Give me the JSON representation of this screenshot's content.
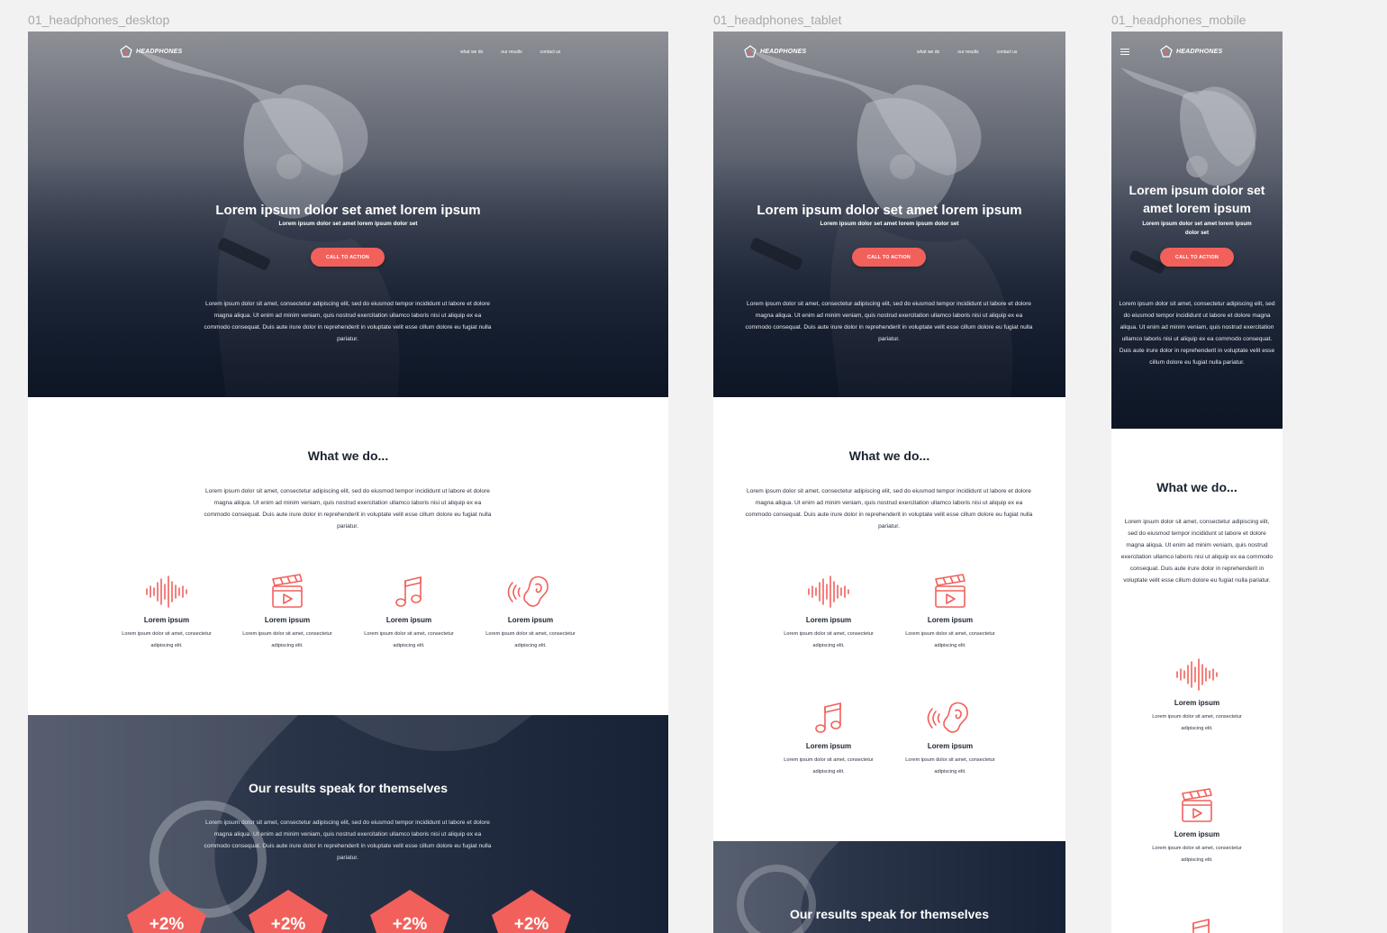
{
  "frames": {
    "desktop_label": "01_headphones_desktop",
    "tablet_label": "01_headphones_tablet",
    "mobile_label": "01_headphones_mobile"
  },
  "brand": {
    "name": "HEADPHONES"
  },
  "nav": {
    "items": [
      "what we do",
      "our results",
      "contact us"
    ]
  },
  "hero": {
    "title": "Lorem ipsum dolor set amet lorem ipsum",
    "subtitle": "Lorem ipsum dolor set amet lorem ipsum dolor set",
    "cta": "CALL TO ACTION",
    "body": "Lorem ipsum dolor sit amet, consectetur adipiscing elit, sed do eiusmod tempor incididunt ut labore et dolore magna aliqua. Ut enim ad minim veniam, quis nostrud exercitation ullamco laboris nisi ut aliquip ex ea commodo consequat. Duis aute irure dolor in reprehenderit in voluptate velit esse cillum dolore eu fugiat nulla pariatur."
  },
  "what_we_do": {
    "title": "What we do...",
    "body": "Lorem ipsum dolor sit amet, consectetur adipiscing elit, sed do eiusmod tempor incididunt ut labore et dolore magna aliqua. Ut enim ad minim veniam, quis nostrud exercitation ullamco laboris nisi ut aliquip ex ea commodo consequat. Duis aute irure dolor in reprehenderit in voluptate velit esse cillum dolore eu fugiat nulla pariatur.",
    "features": [
      {
        "icon": "sound-wave-icon",
        "title": "Lorem ipsum",
        "desc": "Lorem ipsum dolor sit amet, consectetur adipiscing elit."
      },
      {
        "icon": "clapperboard-icon",
        "title": "Lorem ipsum",
        "desc": "Lorem ipsum dolor sit amet, consectetur adipiscing elit."
      },
      {
        "icon": "music-note-icon",
        "title": "Lorem ipsum",
        "desc": "Lorem ipsum dolor sit amet, consectetur adipiscing elit."
      },
      {
        "icon": "ear-icon",
        "title": "Lorem ipsum",
        "desc": "Lorem ipsum dolor sit amet, consectetur adipiscing elit."
      }
    ]
  },
  "results": {
    "title": "Our results speak for themselves",
    "body": "Lorem ipsum dolor sit amet, consectetur adipiscing elit, sed do eiusmod tempor incididunt ut labore et dolore magna aliqua. Ut enim ad minim veniam, quis nostrud exercitation ullamco laboris nisi ut aliquip ex ea commodo consequat. Duis aute irure dolor in reprehenderit in voluptate velit esse cillum dolore eu fugiat nulla pariatur.",
    "stats": [
      "+2%",
      "+2%",
      "+2%",
      "+2%"
    ]
  },
  "colors": {
    "accent": "#f2605b",
    "navy": "#131c2d",
    "canvas": "#f2f2f2"
  }
}
